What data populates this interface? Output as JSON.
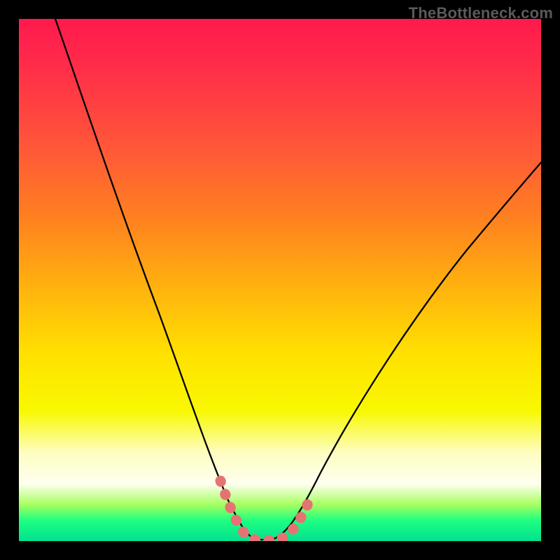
{
  "watermark": "TheBottleneck.com",
  "chart_data": {
    "type": "line",
    "title": "",
    "xlabel": "",
    "ylabel": "",
    "xlim": [
      0,
      100
    ],
    "ylim": [
      0,
      100
    ],
    "series": [
      {
        "name": "bottleneck-curve",
        "x": [
          7,
          10,
          15,
          20,
          25,
          30,
          33,
          36,
          38,
          40,
          42,
          44,
          46,
          48,
          50,
          55,
          60,
          65,
          70,
          75,
          80,
          85,
          90,
          95,
          100
        ],
        "values": [
          100,
          92,
          79,
          66,
          53,
          39,
          30,
          20,
          13,
          7,
          3,
          1,
          0,
          0,
          1,
          4,
          10,
          17,
          24,
          31,
          38,
          44,
          50,
          55,
          60
        ]
      }
    ],
    "highlight": {
      "name": "optimal-range",
      "x": [
        38,
        40,
        42,
        44,
        46,
        48,
        50,
        52
      ],
      "values": [
        13,
        7,
        3,
        1,
        0,
        0,
        1,
        3
      ],
      "color": "#e57373"
    },
    "background_gradient": {
      "top": "#ff1a4d",
      "mid": "#ffe000",
      "bottom": "#00e090"
    }
  }
}
